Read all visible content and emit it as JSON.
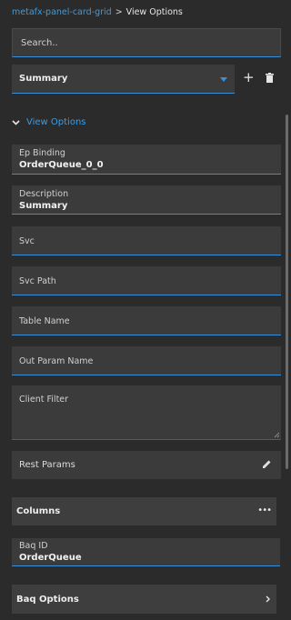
{
  "breadcrumb": {
    "link": "metafx-panel-card-grid",
    "separator": ">",
    "current": "View Options"
  },
  "search": {
    "placeholder": "Search.."
  },
  "view_select": {
    "value": "Summary"
  },
  "toolbar": {
    "add_icon": "plus-icon",
    "delete_icon": "trash-icon"
  },
  "view_options": {
    "label": "View Options",
    "fields": {
      "ep_binding": {
        "label": "Ep Binding",
        "value": "OrderQueue_0_0"
      },
      "description": {
        "label": "Description",
        "value": "Summary"
      },
      "svc": {
        "label": "Svc"
      },
      "svc_path": {
        "label": "Svc Path"
      },
      "table_name": {
        "label": "Table Name"
      },
      "out_param_name": {
        "label": "Out Param Name"
      },
      "client_filter": {
        "label": "Client Filter"
      },
      "rest_params": {
        "label": "Rest Params"
      }
    }
  },
  "columns": {
    "label": "Columns"
  },
  "baq_id": {
    "label": "Baq ID",
    "value": "OrderQueue"
  },
  "baq_options": {
    "label": "Baq Options"
  },
  "colors": {
    "accent": "#3a8fd6",
    "link": "#3f9be0",
    "background": "#2b2b2b",
    "field_bg": "#3b3b3b"
  }
}
